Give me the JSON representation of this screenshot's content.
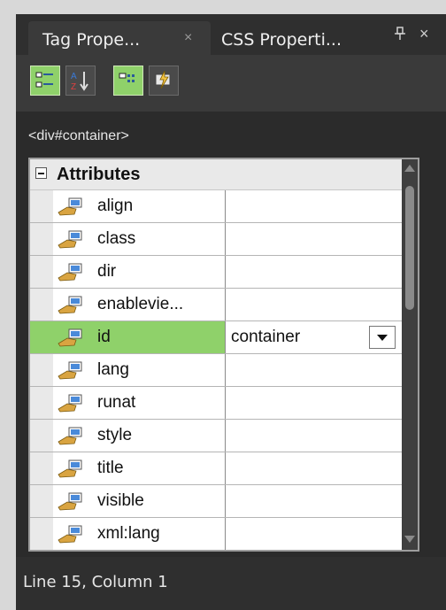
{
  "tabs": {
    "active": {
      "label": "Tag Prope...",
      "close": "×"
    },
    "inactive": {
      "label": "CSS Properti..."
    },
    "pin": "⊤",
    "close": "×"
  },
  "toolbar": {
    "buttons": [
      {
        "icon": "categorized-view-icon",
        "active": true
      },
      {
        "icon": "alphabetical-sort-icon",
        "active": false
      },
      {
        "icon": "show-set-properties-icon",
        "active": true
      },
      {
        "icon": "show-events-icon",
        "active": false
      }
    ]
  },
  "breadcrumb": "<div#container>",
  "grid": {
    "category": "Attributes",
    "properties": [
      {
        "name": "align",
        "value": ""
      },
      {
        "name": "class",
        "value": ""
      },
      {
        "name": "dir",
        "value": ""
      },
      {
        "name": "enablevie...",
        "value": ""
      },
      {
        "name": "id",
        "value": "container"
      },
      {
        "name": "lang",
        "value": ""
      },
      {
        "name": "runat",
        "value": ""
      },
      {
        "name": "style",
        "value": ""
      },
      {
        "name": "title",
        "value": ""
      },
      {
        "name": "visible",
        "value": ""
      },
      {
        "name": "xml:lang",
        "value": ""
      }
    ],
    "selected_index": 4
  },
  "status": "Line 15, Column 1",
  "colors": {
    "accent": "#8fd16a",
    "panel": "#2b2b2b"
  }
}
